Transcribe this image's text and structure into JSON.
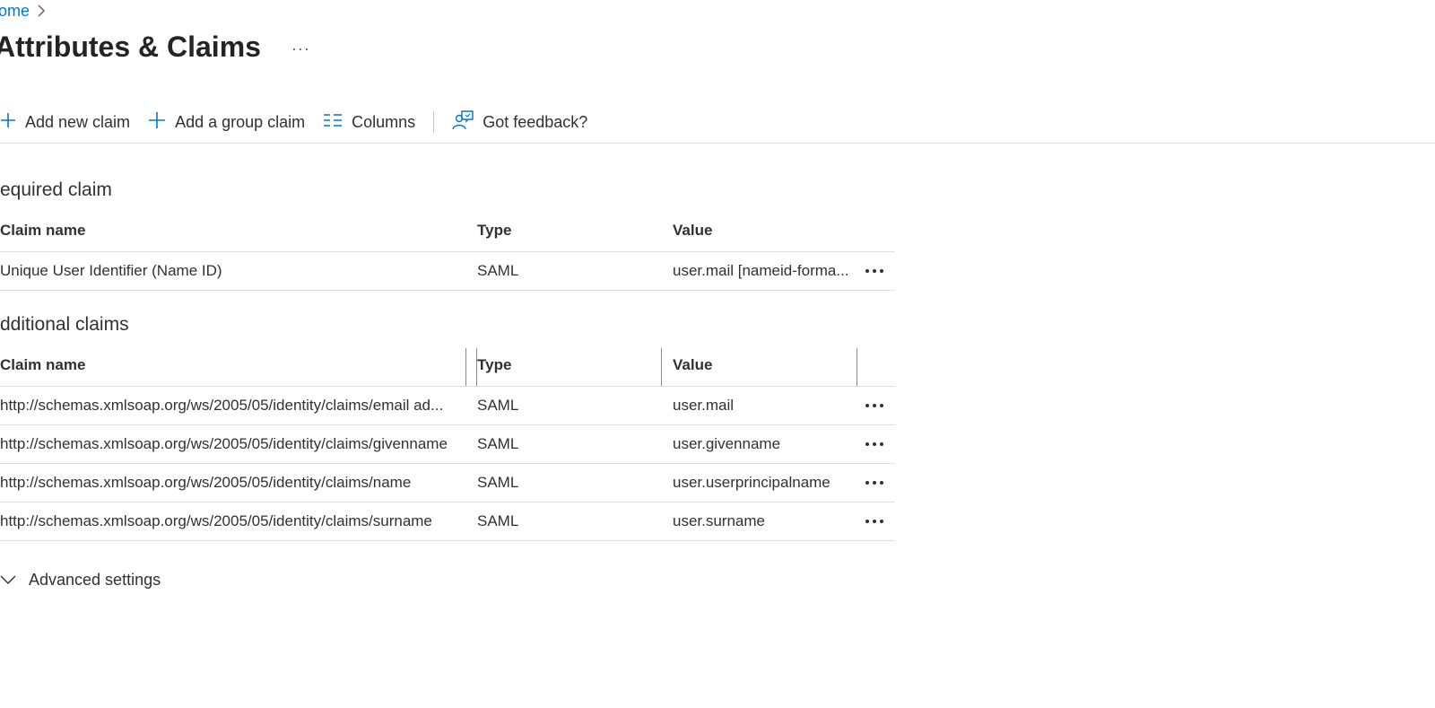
{
  "breadcrumb": {
    "home": "ome"
  },
  "header": {
    "title": "Attributes & Claims",
    "more": "···"
  },
  "toolbar": {
    "add_new_claim": "Add new claim",
    "add_group_claim": "Add a group claim",
    "columns": "Columns",
    "feedback": "Got feedback?"
  },
  "required": {
    "title": "equired claim",
    "headers": {
      "name": "Claim name",
      "type": "Type",
      "value": "Value"
    },
    "rows": [
      {
        "name": "Unique User Identifier (Name ID)",
        "type": "SAML",
        "value": "user.mail [nameid-forma..."
      }
    ]
  },
  "additional": {
    "title": "dditional claims",
    "headers": {
      "name": "Claim name",
      "type": "Type",
      "value": "Value"
    },
    "rows": [
      {
        "name": "http://schemas.xmlsoap.org/ws/2005/05/identity/claims/email ad...",
        "type": "SAML",
        "value": "user.mail"
      },
      {
        "name": "http://schemas.xmlsoap.org/ws/2005/05/identity/claims/givenname",
        "type": "SAML",
        "value": "user.givenname"
      },
      {
        "name": "http://schemas.xmlsoap.org/ws/2005/05/identity/claims/name",
        "type": "SAML",
        "value": "user.userprincipalname"
      },
      {
        "name": "http://schemas.xmlsoap.org/ws/2005/05/identity/claims/surname",
        "type": "SAML",
        "value": "user.surname"
      }
    ]
  },
  "advanced": {
    "label": "Advanced settings"
  },
  "colors": {
    "accent": "#0078d4",
    "text": "#323130",
    "divider": "#e1dfdd"
  }
}
